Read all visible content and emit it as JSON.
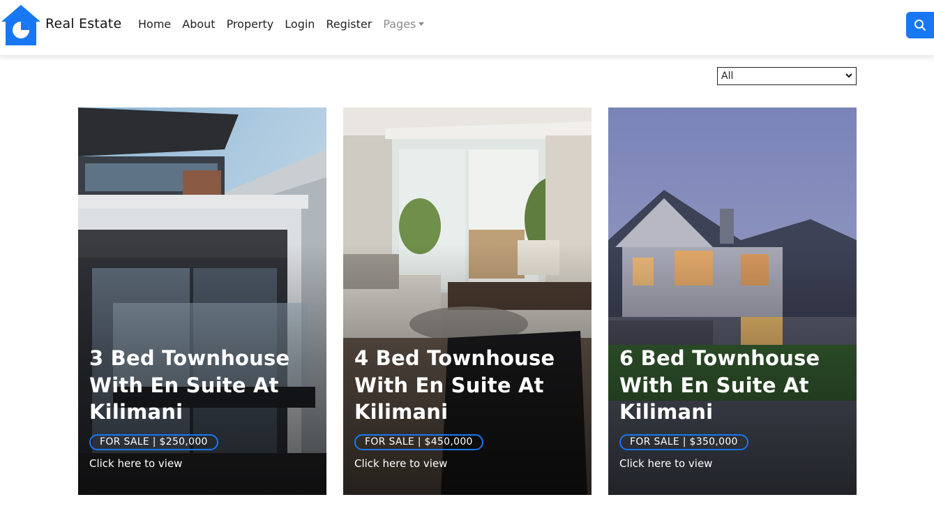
{
  "brand": {
    "name": "Real Estate",
    "logo_icon": "house-pie-icon",
    "accent": "#1877f2"
  },
  "nav": {
    "items": [
      {
        "label": "Home"
      },
      {
        "label": "About"
      },
      {
        "label": "Property"
      },
      {
        "label": "Login"
      },
      {
        "label": "Register"
      },
      {
        "label": "Pages"
      }
    ],
    "search_icon": "search-icon"
  },
  "filter": {
    "selected": "All"
  },
  "listings": [
    {
      "title": "3 Bed Townhouse With En Suite At Kilimani",
      "badge": "FOR SALE | $250,000",
      "link": "Click here to view",
      "image": "modern-house-photo"
    },
    {
      "title": "4 Bed Townhouse With En Suite At Kilimani",
      "badge": "FOR SALE | $450,000",
      "link": "Click here to view",
      "image": "living-room-photo"
    },
    {
      "title": "6 Bed Townhouse With En Suite At Kilimani",
      "badge": "FOR SALE | $350,000",
      "link": "Click here to view",
      "image": "suburban-house-photo"
    }
  ]
}
